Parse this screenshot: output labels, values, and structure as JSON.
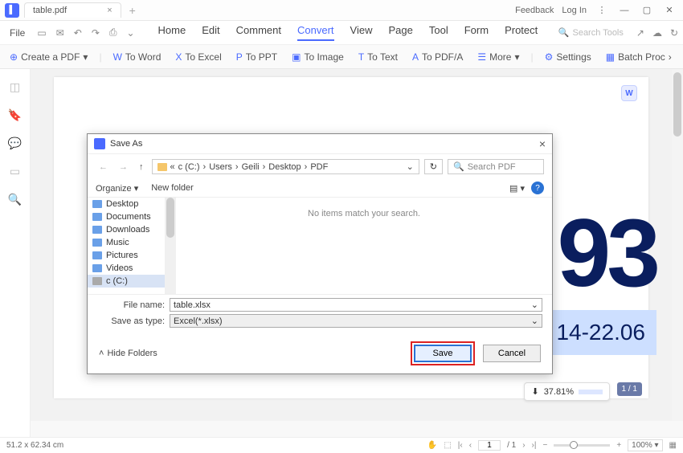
{
  "titlebar": {
    "tab_title": "table.pdf",
    "feedback": "Feedback",
    "login": "Log In"
  },
  "menubar": {
    "file": "File",
    "items": [
      "Home",
      "Edit",
      "Comment",
      "Convert",
      "View",
      "Page",
      "Tool",
      "Form",
      "Protect"
    ],
    "active_index": 3,
    "search_placeholder": "Search Tools"
  },
  "toolbar": {
    "create": "Create a PDF",
    "to_word": "To Word",
    "to_excel": "To Excel",
    "to_ppt": "To PPT",
    "to_image": "To Image",
    "to_text": "To Text",
    "to_pdfa": "To PDF/A",
    "more": "More",
    "settings": "Settings",
    "batch": "Batch Proc"
  },
  "doc": {
    "big_num": "93",
    "highlight_text": "14-22.06",
    "download_pct": "37.81%",
    "page_badge": "1 / 1"
  },
  "dialog": {
    "title": "Save As",
    "path": [
      "c (C:)",
      "Users",
      "Geili",
      "Desktop",
      "PDF"
    ],
    "search_placeholder": "Search PDF",
    "organize": "Organize",
    "new_folder": "New folder",
    "tree": [
      "Desktop",
      "Documents",
      "Downloads",
      "Music",
      "Pictures",
      "Videos",
      "c (C:)"
    ],
    "empty_msg": "No items match your search.",
    "filename_label": "File name:",
    "filename_value": "table.xlsx",
    "savetype_label": "Save as type:",
    "savetype_value": "Excel(*.xlsx)",
    "hide_folders": "Hide Folders",
    "save": "Save",
    "cancel": "Cancel"
  },
  "status": {
    "dims": "51.2 x 62.34 cm",
    "page_current": "1",
    "page_total": "/ 1",
    "zoom": "100%"
  }
}
